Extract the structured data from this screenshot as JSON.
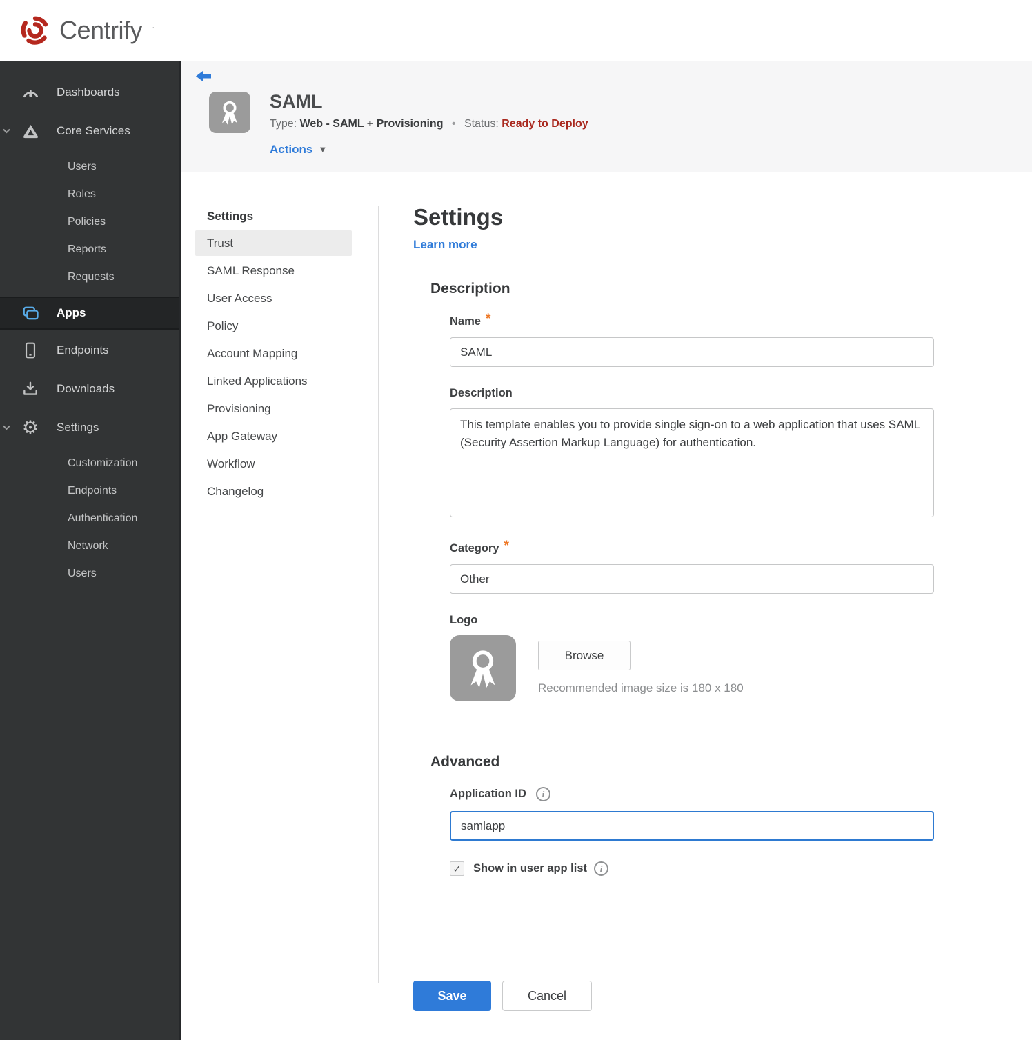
{
  "brand": {
    "name": "Centrify",
    "mark": "·"
  },
  "colors": {
    "accent_blue": "#2f7bd9",
    "status_red": "#a9281e",
    "required_orange": "#ee7623",
    "apps_icon_blue": "#58abe8",
    "sidebar_bg": "#323435"
  },
  "icons": {
    "dropdown_triangle": "▼",
    "info": "i",
    "checkmark": "✓",
    "gear": "⚙"
  },
  "sidebar": {
    "items": [
      {
        "label": "Dashboards"
      },
      {
        "label": "Core Services"
      },
      {
        "label": "Users"
      },
      {
        "label": "Roles"
      },
      {
        "label": "Policies"
      },
      {
        "label": "Reports"
      },
      {
        "label": "Requests"
      },
      {
        "label": "Apps"
      },
      {
        "label": "Endpoints"
      },
      {
        "label": "Downloads"
      },
      {
        "label": "Settings"
      },
      {
        "label": "Customization"
      },
      {
        "label": "Endpoints"
      },
      {
        "label": "Authentication"
      },
      {
        "label": "Network"
      },
      {
        "label": "Users"
      }
    ]
  },
  "app_header": {
    "title": "SAML",
    "type_label": "Type:",
    "type_value": "Web - SAML + Provisioning",
    "separator": "•",
    "status_label": "Status:",
    "status_value": "Ready to Deploy",
    "actions_label": "Actions"
  },
  "subnav": {
    "header": "Settings",
    "items": [
      "Trust",
      "SAML Response",
      "User Access",
      "Policy",
      "Account Mapping",
      "Linked Applications",
      "Provisioning",
      "App Gateway",
      "Workflow",
      "Changelog"
    ],
    "active_item": "Trust"
  },
  "main": {
    "title": "Settings",
    "learn_more": "Learn more",
    "required_mark": "*",
    "description": {
      "heading": "Description",
      "name_label": "Name",
      "name_value": "SAML",
      "description_label": "Description",
      "description_value": "This template enables you to provide single sign-on to a web application that uses SAML (Security Assertion Markup Language) for authentication.",
      "category_label": "Category",
      "category_value": "Other",
      "logo_label": "Logo",
      "browse_label": "Browse",
      "logo_hint": "Recommended image size is 180 x 180"
    },
    "advanced": {
      "heading": "Advanced",
      "app_id_label": "Application ID",
      "app_id_value": "samlapp",
      "show_in_list_label": "Show in user app list",
      "show_in_list_checked": true
    },
    "footer": {
      "save_label": "Save",
      "cancel_label": "Cancel"
    }
  }
}
